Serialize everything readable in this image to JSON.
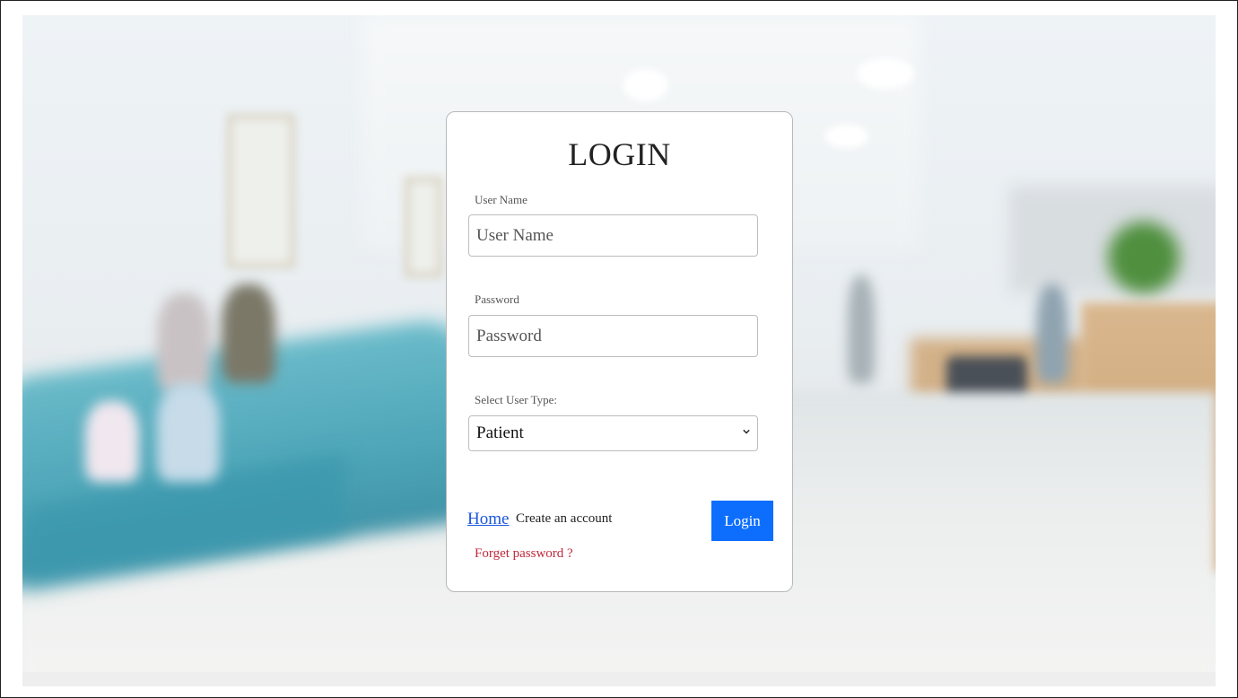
{
  "login_form": {
    "title": "LOGIN",
    "username": {
      "label": "User Name",
      "placeholder": "User Name",
      "value": ""
    },
    "password": {
      "label": "Password",
      "placeholder": "Password",
      "value": ""
    },
    "user_type": {
      "label": "Select User Type:",
      "selected": "Patient"
    },
    "links": {
      "home": "Home",
      "create_account": "Create an account",
      "forget_password": "Forget password ?"
    },
    "login_button": "Login"
  },
  "colors": {
    "login_button_bg": "#0d6efd",
    "home_link": "#1a56db",
    "forget_link": "#c0283c"
  }
}
